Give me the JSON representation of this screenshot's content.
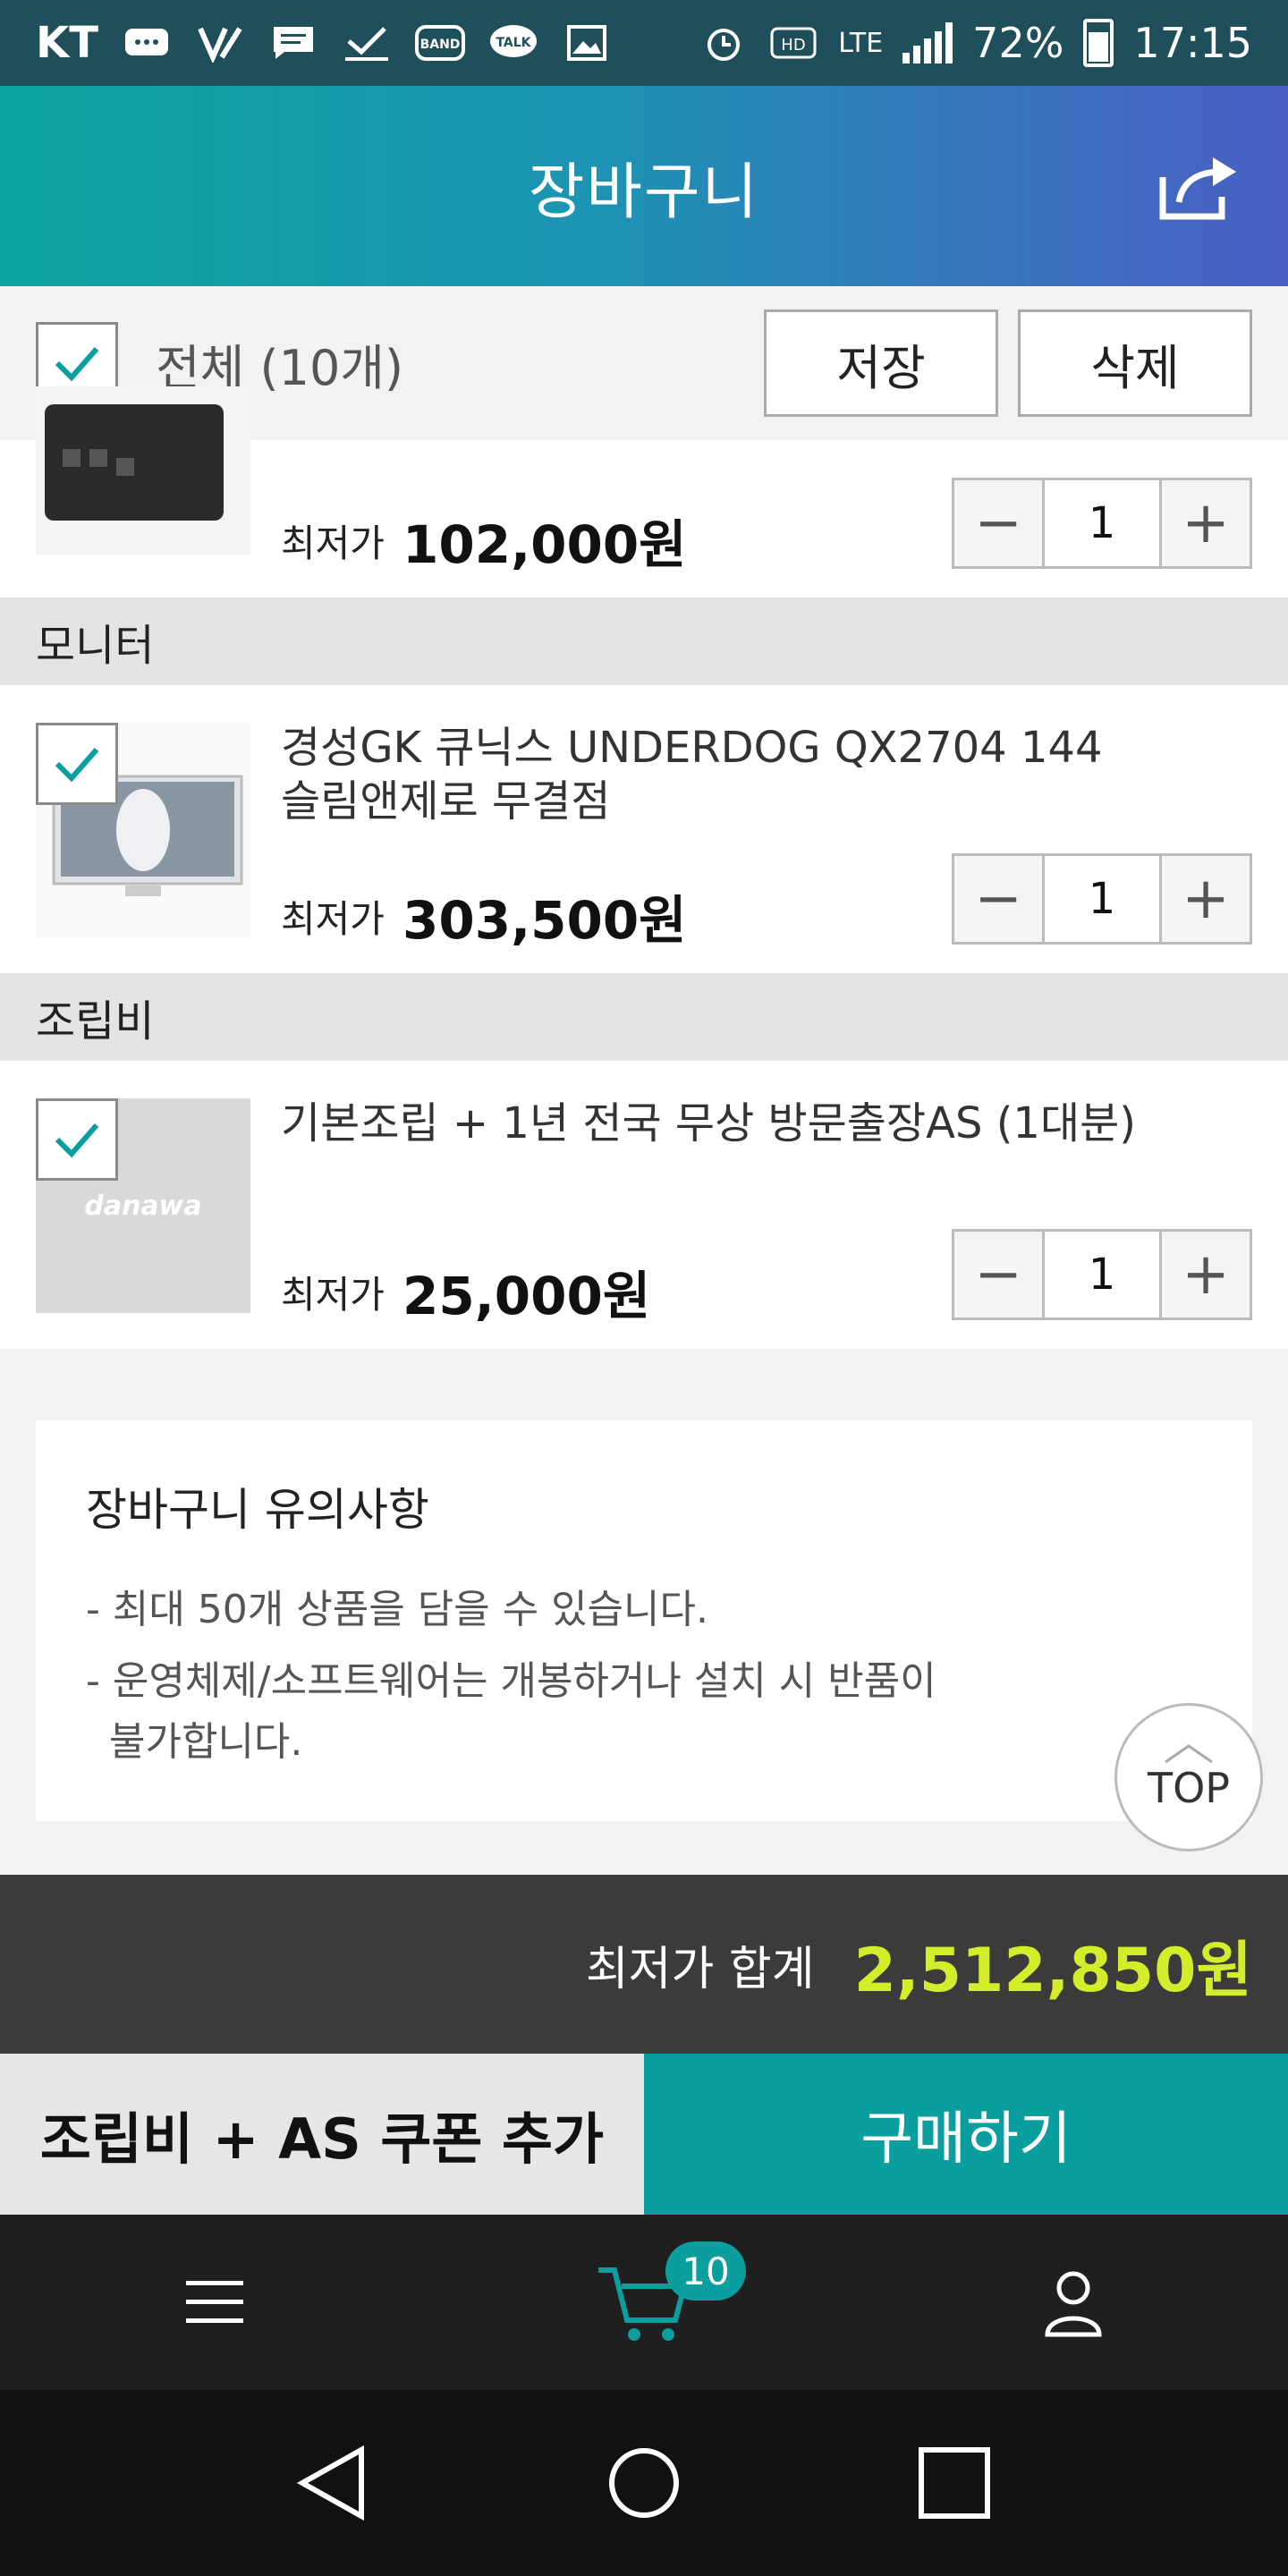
{
  "status_bar": {
    "carrier": "KT",
    "network": "LTE",
    "battery": "72%",
    "time": "17:15",
    "icons": [
      "chat-icon",
      "v-app-icon",
      "message-icon",
      "download-icon",
      "band-icon",
      "talk-icon",
      "gallery-icon",
      "alarm-icon",
      "hd-icon",
      "lte-icon",
      "signal-icon",
      "battery-icon"
    ]
  },
  "header": {
    "title": "장바구니"
  },
  "select_bar": {
    "all_label": "전체 (10개)",
    "save_label": "저장",
    "delete_label": "삭제"
  },
  "items": [
    {
      "price_label": "최저가",
      "price": "102,000원",
      "qty": "1"
    },
    {
      "category": "모니터",
      "name_line1": "경성GK 큐닉스 UNDERDOG QX2704 144",
      "name_line2": "슬림앤제로 무결점",
      "price_label": "최저가",
      "price": "303,500원",
      "qty": "1"
    },
    {
      "category": "조립비",
      "name_line1": "기본조립 + 1년 전국 무상 방문출장AS (1대분)",
      "thumb_logo": "danawa",
      "price_label": "최저가",
      "price": "25,000원",
      "qty": "1"
    }
  ],
  "notice": {
    "title": "장바구니 유의사항",
    "line1": "- 최대 50개 상품을 담을 수 있습니다.",
    "line2": "- 운영체제/소프트웨어는 개봉하거나 설치 시 반품이",
    "line3": "불가합니다."
  },
  "top_button": {
    "label": "TOP"
  },
  "total": {
    "label": "최저가 합계",
    "value": "2,512,850원"
  },
  "actions": {
    "coupon_label": "조립비 + AS 쿠폰 추가",
    "buy_label": "구매하기"
  },
  "bottom_nav": {
    "cart_count": "10"
  },
  "colors": {
    "accent": "#0b9e9e",
    "total_value": "#d4ed2a",
    "header_start": "#0aa4a0",
    "header_end": "#4a5ec4"
  }
}
